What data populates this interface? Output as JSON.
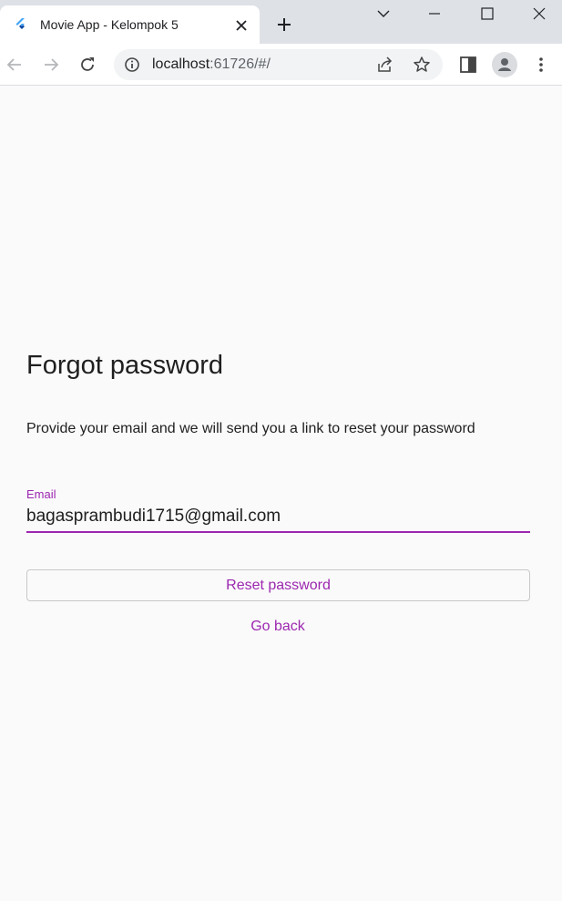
{
  "browser": {
    "tab": {
      "title": "Movie App - Kelompok 5",
      "favicon": "flutter-icon"
    },
    "url": {
      "host": "localhost",
      "rest": ":61726/#/"
    },
    "icons": [
      "back-icon",
      "forward-icon",
      "reload-icon",
      "info-icon",
      "share-icon",
      "star-icon",
      "side-panel-icon",
      "profile-icon",
      "menu-icon",
      "new-tab-icon",
      "tab-search-icon",
      "minimize-icon",
      "maximize-icon",
      "close-icon"
    ],
    "colors": {
      "tabstrip": "#dee1e6",
      "toolbar": "#ffffff",
      "omnibox": "#f1f3f4"
    }
  },
  "form": {
    "title": "Forgot password",
    "description": "Provide your email and we will send you a link to reset your password",
    "email_label": "Email",
    "email_value": "bagasprambudi1715@gmail.com",
    "reset_label": "Reset password",
    "goback_label": "Go back"
  },
  "colors": {
    "accent": "#9c27b0",
    "background": "#fafafa",
    "text": "#1f1f1f"
  }
}
